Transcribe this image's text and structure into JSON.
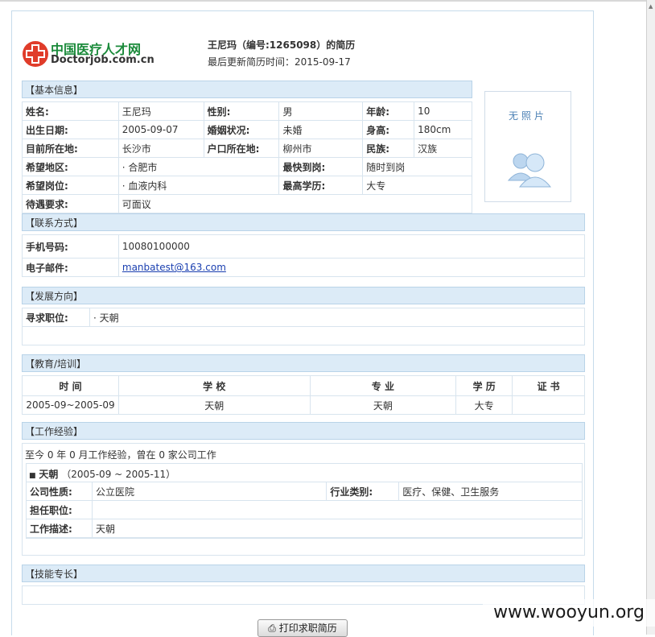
{
  "header": {
    "logo_cn": "中国医疗人才网",
    "logo_en": "Doctorjob.com.cn",
    "resume_title": "王尼玛（编号:1265098）的简历",
    "updated": "最后更新简历时间：2015-09-17"
  },
  "basic": {
    "section": "【基本信息】",
    "name_label": "姓名:",
    "name": "王尼玛",
    "gender_label": "性别:",
    "gender": "男",
    "age_label": "年龄:",
    "age": "10",
    "birth_label": "出生日期:",
    "birth": "2005-09-07",
    "marital_label": "婚姻状况:",
    "marital": "未婚",
    "height_label": "身高:",
    "height": "180cm",
    "location_label": "目前所在地:",
    "location": "长沙市",
    "hukou_label": "户口所在地:",
    "hukou": "柳州市",
    "ethnic_label": "民族:",
    "ethnic": "汉族",
    "wish_area_label": "希望地区:",
    "wish_area": "· 合肥市",
    "start_label": "最快到岗:",
    "start": "随时到岗",
    "wish_post_label": "希望岗位:",
    "wish_post": "· 血液内科",
    "edu_label": "最高学历:",
    "edu": "大专",
    "salary_label": "待遇要求:",
    "salary": "可面议",
    "photo_text": "无照片"
  },
  "contact": {
    "section": "【联系方式】",
    "phone_label": "手机号码:",
    "phone": "10080100000",
    "email_label": "电子邮件:",
    "email": "manbatest@163.com"
  },
  "direction": {
    "section": "【发展方向】",
    "job_label": "寻求职位:",
    "job": "· 天朝"
  },
  "education": {
    "section": "【教育/培训】",
    "headers": [
      "时 间",
      "学 校",
      "专 业",
      "学 历",
      "证 书"
    ],
    "rows": [
      [
        "2005-09~2005-09",
        "天朝",
        "天朝",
        "大专",
        ""
      ]
    ]
  },
  "work": {
    "section": "【工作经验】",
    "summary": "至今 0 年 0 月工作经验，曾在 0 家公司工作",
    "company": "天朝",
    "period": "（2005-09 ~ 2005-11）",
    "nature_label": "公司性质:",
    "nature": "公立医院",
    "industry_label": "行业类别:",
    "industry": "医疗、保健、卫生服务",
    "post_label": "担任职位:",
    "post": "",
    "desc_label": "工作描述:",
    "desc": "天朝"
  },
  "skills": {
    "section": "【技能专长】"
  },
  "print_button": "打印求职简历",
  "watermark": "www.wooyun.org",
  "colors": {
    "section_bg": "#dcebf7",
    "border": "#d8e4ee",
    "logo_green": "#1a8a3a",
    "logo_red": "#e03c2a"
  }
}
